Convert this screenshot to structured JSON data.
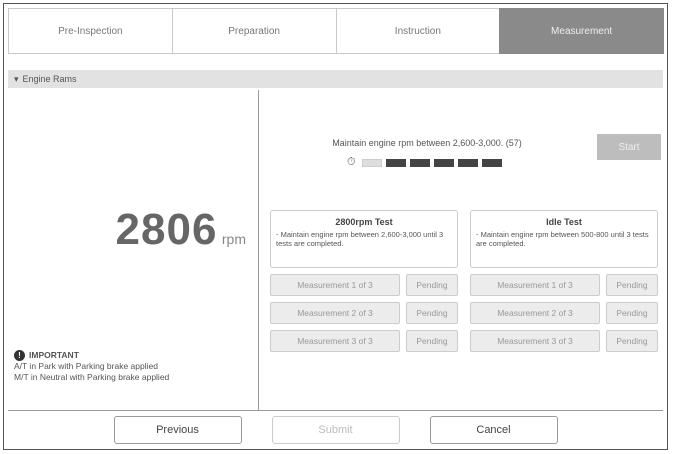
{
  "tabs": [
    {
      "label": "Pre-Inspection",
      "active": false
    },
    {
      "label": "Preparation",
      "active": false
    },
    {
      "label": "Instruction",
      "active": false
    },
    {
      "label": "Measurement",
      "active": true
    }
  ],
  "section": {
    "label": "Engine Rams",
    "icon": "chevron-down-icon"
  },
  "rpm": {
    "value": "2806",
    "unit": "rpm"
  },
  "important": {
    "title": "IMPORTANT",
    "lines": [
      "A/T in Park with Parking brake applied",
      "M/T in Neutral with Parking brake applied"
    ]
  },
  "instruction": {
    "text": "Maintain engine rpm between 2,600-3,000. (57)",
    "progress_filled": 5,
    "progress_total": 6
  },
  "start_label": "Start",
  "tests": [
    {
      "title": "2800rpm Test",
      "desc": "- Maintain engine rpm between 2,600-3,000 until 3 tests are completed.",
      "measurements": [
        {
          "name": "Measurement 1 of 3",
          "status": "Pending"
        },
        {
          "name": "Measurement 2 of 3",
          "status": "Pending"
        },
        {
          "name": "Measurement 3 of 3",
          "status": "Pending"
        }
      ]
    },
    {
      "title": "Idle Test",
      "desc": "- Maintain engine rpm between 500-800 until 3 tests are completed.",
      "measurements": [
        {
          "name": "Measurement 1 of 3",
          "status": "Pending"
        },
        {
          "name": "Measurement 2 of 3",
          "status": "Pending"
        },
        {
          "name": "Measurement 3 of 3",
          "status": "Pending"
        }
      ]
    }
  ],
  "footer": {
    "previous": "Previous",
    "next": "Submit",
    "cancel": "Cancel"
  }
}
